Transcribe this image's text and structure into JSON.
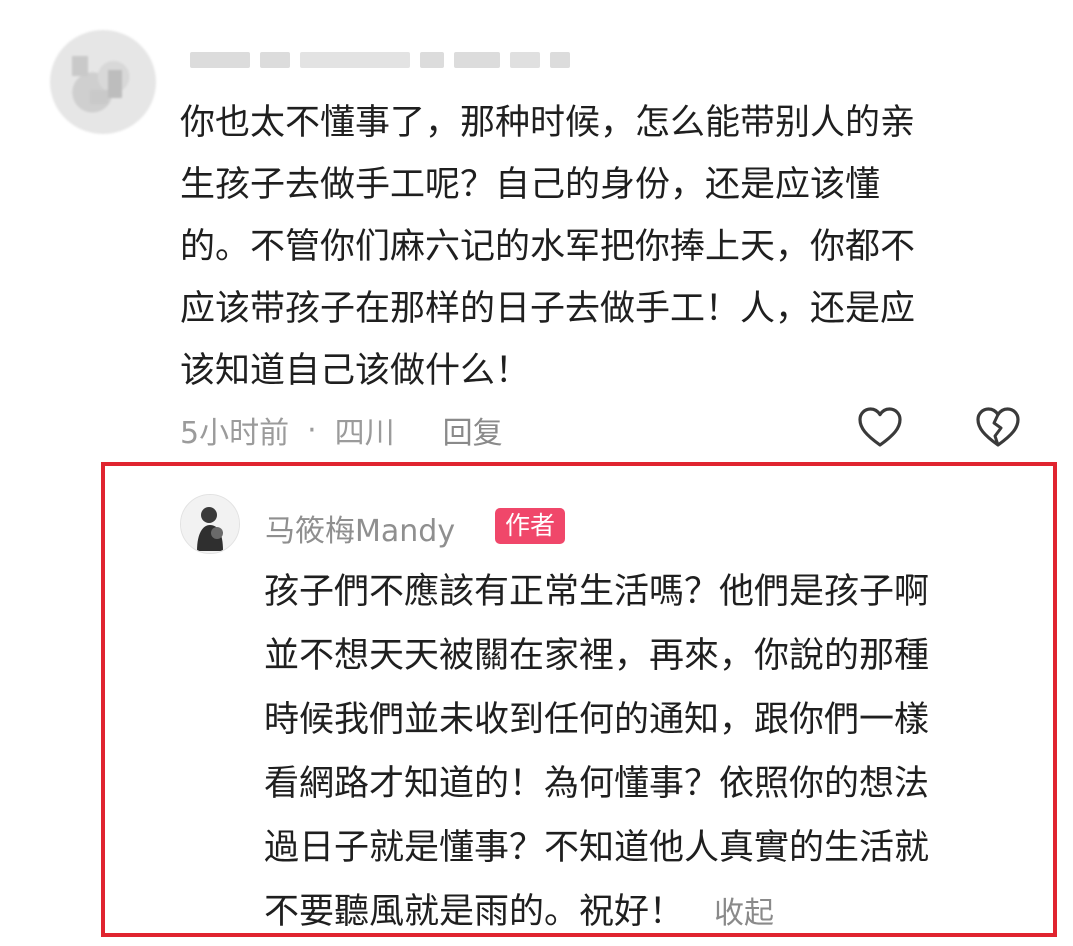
{
  "comment": {
    "lines": [
      "你也太不懂事了，那种时候，怎么能带别人的亲",
      "生孩子去做手工呢？自己的身份，还是应该懂",
      "的。不管你们麻六记的水军把你捧上天，你都不",
      "应该带孩子在那样的日子去做手工！人，还是应",
      "该知道自己该做什么！"
    ],
    "time": "5小时前",
    "separator": "·",
    "location": "四川",
    "reply_label": "回复",
    "like_icon": "heart-outline-icon",
    "dislike_icon": "broken-heart-icon"
  },
  "reply": {
    "author_name": "马筱梅Mandy",
    "author_badge": "作者",
    "lines": [
      "孩子們不應該有正常生活嗎？他們是孩子啊",
      "並不想天天被關在家裡，再來，你說的那種",
      "時候我們並未收到任何的通知，跟你們一樣",
      "看網路才知道的！為何懂事？依照你的想法",
      "過日子就是懂事？不知道他人真實的生活就",
      "不要聽風就是雨的。祝好！"
    ],
    "collapse_label": "收起"
  },
  "colors": {
    "highlight_border": "#e0242f",
    "badge_bg": "#f0476a",
    "meta_text": "#9b9b9b",
    "body_text": "#1f1f1f"
  }
}
